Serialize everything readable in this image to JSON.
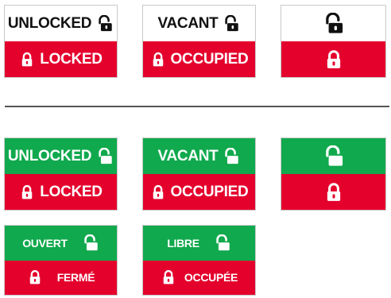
{
  "colors": {
    "red": "#e4022d",
    "green": "#10a94d",
    "white": "#ffffff",
    "black": "#111111"
  },
  "rows": {
    "white_red": {
      "unlocked_label": "UNLOCKED",
      "locked_label": "LOCKED",
      "vacant_label": "VACANT",
      "occupied_label": "OCCUPIED"
    },
    "green_red": {
      "unlocked_label": "UNLOCKED",
      "locked_label": "LOCKED",
      "vacant_label": "VACANT",
      "occupied_label": "OCCUPIED"
    },
    "french": {
      "ouvert_label": "OUVERT",
      "ferme_label": "FERMÉ",
      "libre_label": "LIBRE",
      "occupee_label": "OCCUPÉE"
    }
  },
  "icons": {
    "open": "unlocked-padlock-icon",
    "closed": "locked-padlock-icon"
  }
}
